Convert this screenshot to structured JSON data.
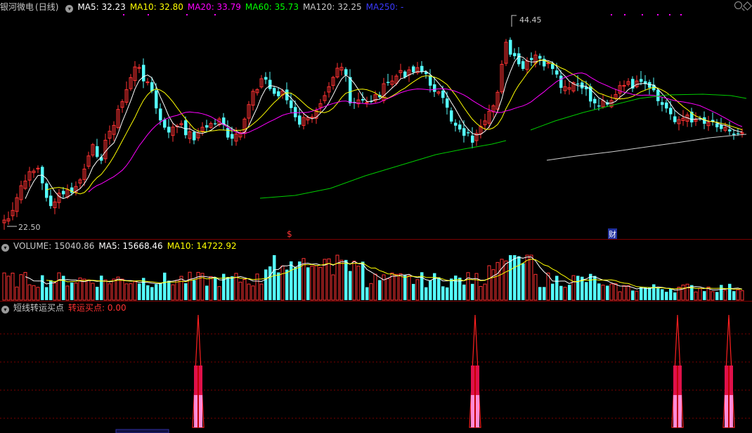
{
  "price": {
    "stock_name": "银河微电",
    "period": "(日线)",
    "indicators": [
      {
        "label": "MA5: 32.23",
        "color": "#ffffff"
      },
      {
        "label": "MA10: 32.80",
        "color": "#ffff00"
      },
      {
        "label": "MA20: 33.79",
        "color": "#ff00ff"
      },
      {
        "label": "MA60: 35.73",
        "color": "#00ff00"
      },
      {
        "label": "MA120: 32.25",
        "color": "#c8c8c8"
      },
      {
        "label": "MA250: -",
        "color": "#3a3aff"
      }
    ],
    "high_label": "44.45",
    "low_label": "22.50",
    "markers": {
      "dollar": "$",
      "cai": "财"
    }
  },
  "volume": {
    "title": "VOLUME: 15040.86",
    "ma5": "MA5: 15668.46",
    "ma10": "MA10: 14722.92"
  },
  "indicator": {
    "title": "短线转运买点",
    "value_label": "转运买点: 0.00"
  },
  "colors": {
    "up": "#ff3232",
    "down": "#54fcfc",
    "grid": "#7a0000",
    "background": "#000000"
  },
  "icons": [
    "collapse-circle-icon",
    "magnifier-icon",
    "diamond-icon"
  ]
}
